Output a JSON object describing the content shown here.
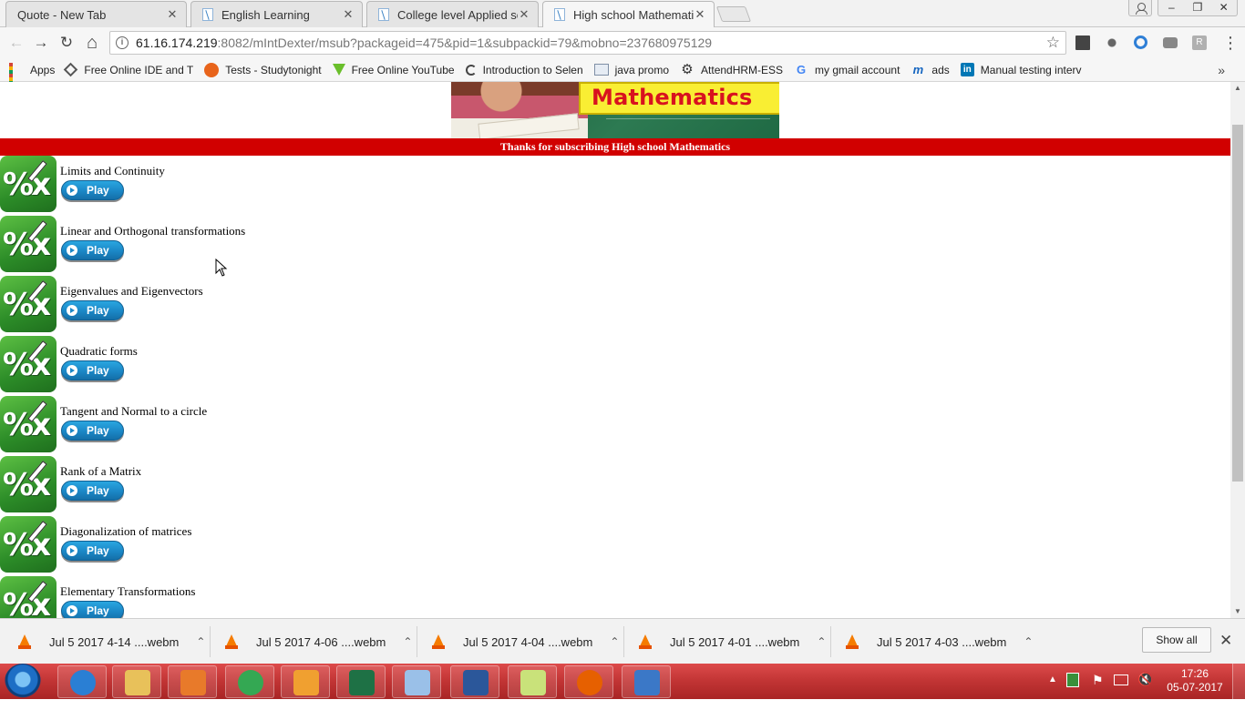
{
  "browser": {
    "tabs": [
      {
        "title": "Quote - New Tab",
        "active": false
      },
      {
        "title": "English Learning",
        "active": false
      },
      {
        "title": "College level Applied sci",
        "active": false
      },
      {
        "title": "High school Mathematic",
        "active": true
      }
    ],
    "tab_close": "✕",
    "address": {
      "host": "61.16.174.219",
      "rest": ":8082/mIntDexter/msub?packageid=475&pid=1&subpackid=79&mobno=237680975129"
    },
    "window_controls": {
      "minimize": "–",
      "restore": "❐",
      "close": "✕"
    },
    "nav": {
      "back": "←",
      "forward": "→",
      "reload": "↻",
      "home": "⌂",
      "star": "☆",
      "menu": "⋮"
    }
  },
  "bookmarks": [
    {
      "label": "Apps",
      "icon": "apps-grid-icon"
    },
    {
      "label": "Free Online IDE and T",
      "icon": "ide-icon",
      "color": "#555555"
    },
    {
      "label": "Tests - Studytonight",
      "icon": "studytonight-icon",
      "color": "#e8641b"
    },
    {
      "label": "Free Online YouTube",
      "icon": "download-arrow-icon",
      "color": "#6abf2b"
    },
    {
      "label": "Introduction to Selen",
      "icon": "selenium-icon",
      "color": "#444444"
    },
    {
      "label": "java promo",
      "icon": "image-icon",
      "color": "#7f8fa6"
    },
    {
      "label": "AttendHRM-ESS",
      "icon": "gear-icon",
      "color": "#333333"
    },
    {
      "label": "my gmail account",
      "icon": "google-icon",
      "color": "#4285f4"
    },
    {
      "label": "ads",
      "icon": "m-logo-icon",
      "color": "#1565c0"
    },
    {
      "label": "Manual testing interv",
      "icon": "linkedin-icon",
      "color": "#0077b5"
    }
  ],
  "bookmarks_more": "»",
  "page": {
    "banner_title": "Mathematics",
    "subscription_message": "Thanks for subscribing High school Mathematics",
    "icon_glyph": "%x",
    "play_label": "Play",
    "topics": [
      "Limits and Continuity",
      "Linear and Orthogonal transformations",
      "Eigenvalues and Eigenvectors",
      "Quadratic forms",
      "Tangent and Normal to a circle",
      "Rank of a Matrix",
      "Diagonalization of matrices",
      "Elementary Transformations"
    ]
  },
  "downloads": {
    "items": [
      "Jul 5 2017 4-14 ....webm",
      "Jul 5 2017 4-06 ....webm",
      "Jul 5 2017 4-04 ....webm",
      "Jul 5 2017 4-01 ....webm",
      "Jul 5 2017 4-03 ....webm"
    ],
    "chevron": "⌃",
    "show_all": "Show all",
    "close": "✕"
  },
  "taskbar": {
    "apps": [
      {
        "name": "internet-explorer",
        "color": "#2a7fd4"
      },
      {
        "name": "file-explorer",
        "color": "#e8c15a"
      },
      {
        "name": "media-player",
        "color": "#e87a2a"
      },
      {
        "name": "chrome",
        "color": "#34a853"
      },
      {
        "name": "outlook",
        "color": "#f0a030"
      },
      {
        "name": "excel",
        "color": "#1e7145"
      },
      {
        "name": "paint",
        "color": "#9ac0e8"
      },
      {
        "name": "word",
        "color": "#2b579a"
      },
      {
        "name": "sticky-notes",
        "color": "#c9e27a"
      },
      {
        "name": "firefox",
        "color": "#e66000"
      },
      {
        "name": "control-panel",
        "color": "#3b78c7"
      }
    ],
    "clock_time": "17:26",
    "clock_date": "05-07-2017"
  }
}
